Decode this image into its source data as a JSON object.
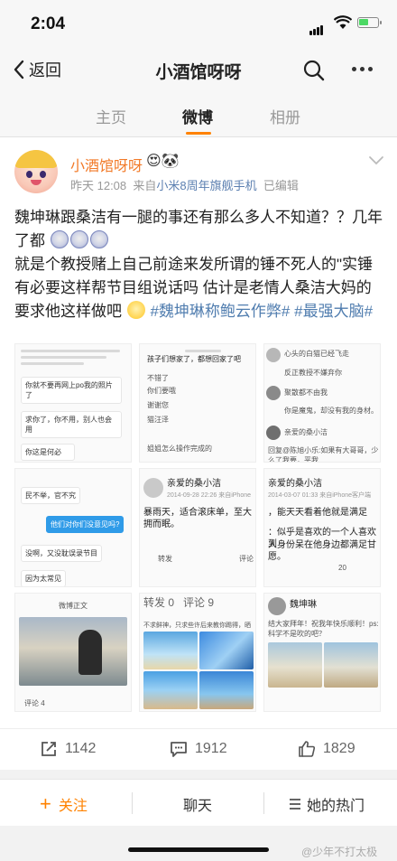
{
  "status": {
    "time": "2:04"
  },
  "nav": {
    "back_label": "返回",
    "title": "小酒馆呀呀"
  },
  "tabs": [
    {
      "label": "主页"
    },
    {
      "label": "微博"
    },
    {
      "label": "相册"
    }
  ],
  "post": {
    "username": "小酒馆呀呀",
    "username_emoji": "😍🐼",
    "time": "昨天 12:08",
    "source_prefix": "来自",
    "source": "小米8周年旗舰手机",
    "edited": "已编辑",
    "text_line1": "魏坤琳跟桑洁有一腿的事还有那么多人不知道？？几年了都",
    "text_line2": "就是个教授赌上自己前途来发所谓的锤不死人的\"实锤 有必要这样帮节目组说话吗 估计是老情人桑洁大妈的要求他这样做吧",
    "tag1": "#魏坤琳称鲍云作弊#",
    "tag2": "#最强大脑#",
    "images": {
      "c1": [
        "你就不要再网上po我的照片了",
        "求你了，你不用，别人也会用",
        "你这是何必"
      ],
      "c2": [
        "孩子们想家了，都想回家了吧",
        "不错了",
        "你们要哦",
        "谢谢您",
        "猫汪泽",
        "姐姐怎么操作完成的"
      ],
      "c3": [
        "心头的白猫已经飞走",
        "反正教授不嫌弃你",
        "聚散都不由我",
        "你是魔鬼，却没有我的身材。",
        "亲爱的桑小洁",
        "回复@陈旭小乐:如果有大哥哥，少么了我要，平我"
      ],
      "c4": [
        "民不举，官不究",
        "他们对你们没意见吗?",
        "没啊，又没耽误录节目",
        "因为太常见"
      ],
      "c5": [
        "亲爱的桑小洁",
        "2014-09-28 22:26  来自iPhone",
        "暴雨天，适合滚床单，至大拥而眠。",
        "转发",
        "评论"
      ],
      "c6": [
        "亲爱的桑小洁",
        "2014-03-07 01:33  来自iPhone客户端",
        "，能天天看着他就是满足",
        "：似乎是喜欢的一个人喜欢到",
        "人身份呆在他身边都满足甘愿。",
        "20"
      ],
      "c7": [
        "微博正文",
        "评论 4"
      ],
      "c8": [
        "转发 0",
        "评论 9",
        "不求鲜神，只求些许后来教你踢得，晒安！"
      ],
      "c9": [
        "魏坤琳",
        "结大家拜年！祝我年快乐顺利！ps: 科学不是吹的吧？"
      ]
    }
  },
  "actions": {
    "repost_count": "1142",
    "comment_count": "1912",
    "like_count": "1829"
  },
  "bottom": {
    "follow": "关注",
    "follow_plus": "+",
    "chat": "聊天",
    "hot": "她的热门"
  },
  "watermark": "@少年不打太极",
  "colors": {
    "accent": "#ff8200",
    "link": "#507daf",
    "username": "#f27a28"
  }
}
